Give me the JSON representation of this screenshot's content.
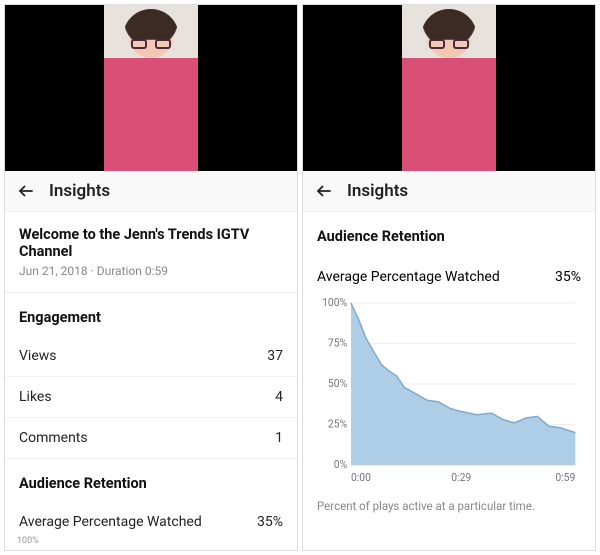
{
  "left": {
    "header": {
      "title": "Insights"
    },
    "video_title": "Welcome to the Jenn's Trends IGTV Channel",
    "video_meta": "Jun 21, 2018 · Duration 0:59",
    "engagement": {
      "heading": "Engagement",
      "views_label": "Views",
      "views_value": "37",
      "likes_label": "Likes",
      "likes_value": "4",
      "comments_label": "Comments",
      "comments_value": "1"
    },
    "retention": {
      "heading": "Audience Retention",
      "avg_label": "Average Percentage Watched",
      "avg_value": "35%",
      "partial_tick": "100%"
    }
  },
  "right": {
    "header": {
      "title": "Insights"
    },
    "retention": {
      "heading": "Audience Retention",
      "avg_label": "Average Percentage Watched",
      "avg_value": "35%"
    },
    "caption": "Percent of plays active at a particular time.",
    "y_ticks": [
      "100%",
      "75%",
      "50%",
      "25%",
      "0%"
    ],
    "x_ticks": [
      "0:00",
      "0:29",
      "0:59"
    ]
  },
  "chart_data": {
    "type": "area",
    "title": "Audience Retention",
    "xlabel": "",
    "ylabel": "",
    "x": [
      0,
      2,
      4,
      6,
      8,
      10,
      12,
      14,
      17,
      20,
      23,
      26,
      29,
      33,
      37,
      40,
      43,
      46,
      49,
      52,
      55,
      59
    ],
    "y": [
      100,
      90,
      78,
      70,
      62,
      58,
      55,
      48,
      44,
      40,
      39,
      35,
      33,
      31,
      32,
      28,
      26,
      29,
      30,
      24,
      23,
      20
    ],
    "xlim": [
      0,
      59
    ],
    "ylim": [
      0,
      100
    ],
    "series_color": "#aecde6",
    "stroke_color": "#7fa9c9"
  }
}
